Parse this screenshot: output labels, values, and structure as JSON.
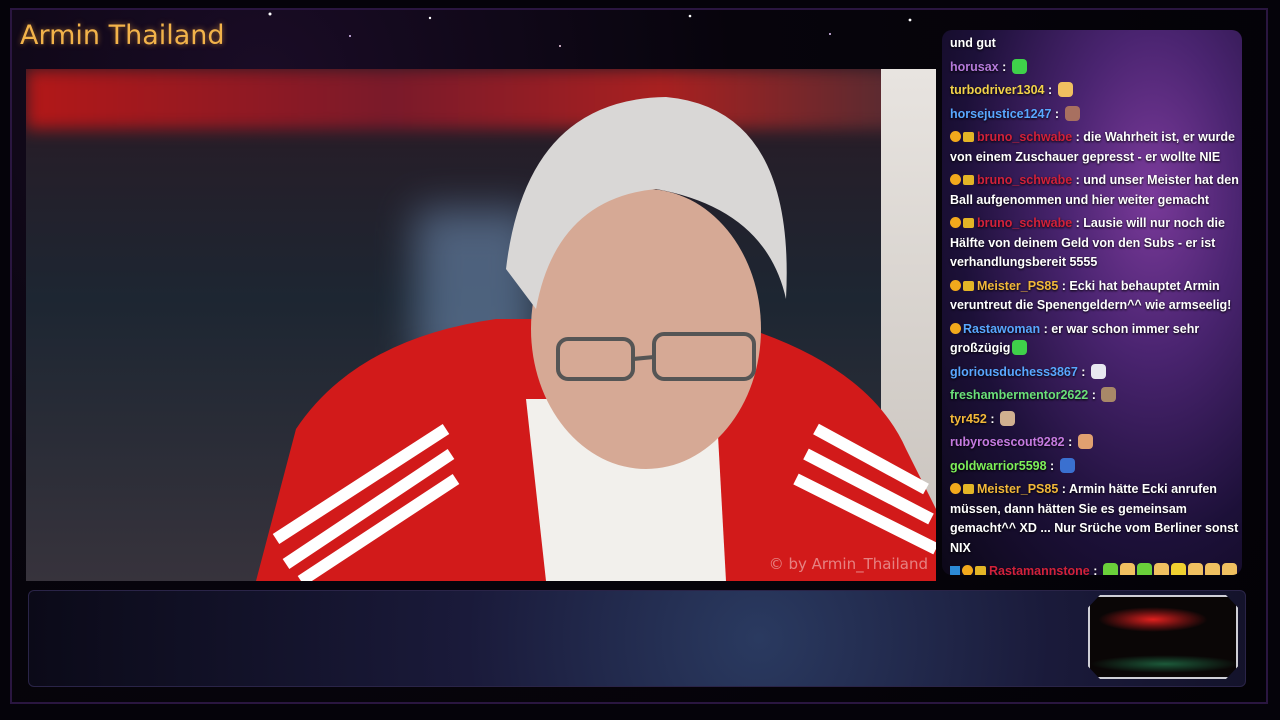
{
  "stream": {
    "title": "Armin Thailand",
    "watermark": "© by Armin_Thailand"
  },
  "chat": {
    "messages": [
      {
        "user": "",
        "text": "und gut",
        "user_color": "#ffffff",
        "badges": [],
        "emotes": []
      },
      {
        "user": "horusax",
        "text": "",
        "user_color": "#b57adb",
        "badges": [],
        "emotes": [
          "green-blob"
        ]
      },
      {
        "user": "turbodriver1304",
        "text": "",
        "user_color": "#f2d24a",
        "badges": [],
        "emotes": [
          "cat-hand"
        ]
      },
      {
        "user": "horsejustice1247",
        "text": "",
        "user_color": "#59a7ff",
        "badges": [],
        "emotes": [
          "portrait"
        ]
      },
      {
        "user": "bruno_schwabe",
        "text": "die Wahrheit ist, er wurde von einem Zuschauer gepresst - er wollte NIE",
        "user_color": "#d1213a",
        "badges": [
          "gold-badge",
          "crown-badge"
        ],
        "emotes": []
      },
      {
        "user": "bruno_schwabe",
        "text": "und unser Meister hat den Ball aufgenommen und hier weiter gemacht",
        "user_color": "#d1213a",
        "badges": [
          "gold-badge",
          "crown-badge"
        ],
        "emotes": []
      },
      {
        "user": "bruno_schwabe",
        "text": "Lausie will nur noch die Hälfte von deinem Geld von den Subs - er ist verhandlungsbereit 5555",
        "user_color": "#d1213a",
        "badges": [
          "gold-badge",
          "crown-badge"
        ],
        "emotes": []
      },
      {
        "user": "Meister_PS85",
        "text": "Ecki hat behauptet Armin veruntreut die Spenengeldern^^ wie armseelig!",
        "user_color": "#f2b83a",
        "badges": [
          "gold-badge",
          "crown-badge"
        ],
        "emotes": []
      },
      {
        "user": "Rastawoman",
        "text": "er war schon immer sehr großzügig",
        "user_color": "#59a7ff",
        "badges": [
          "gold-badge"
        ],
        "emotes": [
          "green-blob"
        ]
      },
      {
        "user": "gloriousduchess3867",
        "text": "",
        "user_color": "#59a7ff",
        "badges": [],
        "emotes": [
          "ghost"
        ]
      },
      {
        "user": "freshambermentor2622",
        "text": "",
        "user_color": "#6be07a",
        "badges": [],
        "emotes": [
          "cat-face"
        ]
      },
      {
        "user": "tyr452",
        "text": "",
        "user_color": "#f2b83a",
        "badges": [],
        "emotes": [
          "figure"
        ]
      },
      {
        "user": "rubyrosescout9282",
        "text": "",
        "user_color": "#c57ae0",
        "badges": [],
        "emotes": [
          "face"
        ]
      },
      {
        "user": "goldwarrior5598",
        "text": "",
        "user_color": "#7ef05a",
        "badges": [],
        "emotes": [
          "car"
        ]
      },
      {
        "user": "Meister_PS85",
        "text": "Armin hätte Ecki anrufen müssen, dann hätten Sie es gemeinsam gemacht^^ XD ... Nur Srüche vom Berliner sonst NIX",
        "user_color": "#f2b83a",
        "badges": [
          "gold-badge",
          "crown-badge"
        ],
        "emotes": []
      },
      {
        "user": "Rastamannstone",
        "text": "",
        "user_color": "#d1213a",
        "badges": [
          "blue-badge",
          "gold-badge",
          "crown-badge"
        ],
        "emotes": [
          "bars",
          "cat-hand",
          "bars",
          "cat-hand",
          "moon",
          "cat-hand",
          "cat-hand",
          "cat-hand",
          "cat-hand"
        ]
      }
    ]
  }
}
